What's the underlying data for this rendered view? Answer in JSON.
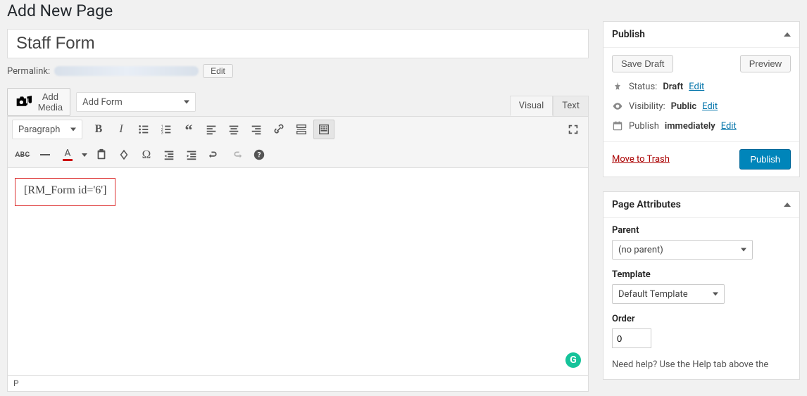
{
  "heading": "Add New Page",
  "title_value": "Staff Form",
  "permalink_label": "Permalink:",
  "permalink_edit": "Edit",
  "add_media": "Add Media",
  "add_form": "Add Form",
  "tabs": {
    "visual": "Visual",
    "text": "Text"
  },
  "format_select": "Paragraph",
  "shortcode_text": "[RM_Form id='6']",
  "status_path": "P",
  "publish": {
    "title": "Publish",
    "save_draft": "Save Draft",
    "preview": "Preview",
    "status_label": "Status:",
    "status_value": "Draft",
    "visibility_label": "Visibility:",
    "visibility_value": "Public",
    "schedule_label": "Publish",
    "schedule_value": "immediately",
    "edit": "Edit",
    "trash": "Move to Trash",
    "publish_btn": "Publish"
  },
  "attrs": {
    "title": "Page Attributes",
    "parent_label": "Parent",
    "parent_value": "(no parent)",
    "template_label": "Template",
    "template_value": "Default Template",
    "order_label": "Order",
    "order_value": "0",
    "help_text": "Need help? Use the Help tab above the"
  }
}
